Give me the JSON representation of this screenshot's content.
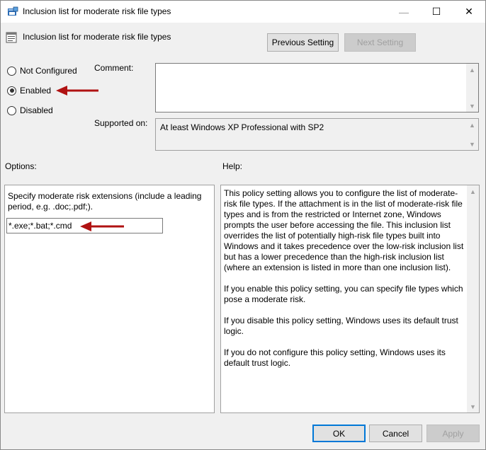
{
  "window": {
    "title": "Inclusion list for moderate risk file types",
    "minimize_glyph": "—",
    "maximize_glyph": "☐",
    "close_glyph": "✕"
  },
  "header": {
    "title": "Inclusion list for moderate risk file types",
    "prev_label": "Previous Setting",
    "next_label": "Next Setting"
  },
  "state": {
    "options": [
      "Not Configured",
      "Enabled",
      "Disabled"
    ],
    "selected": "Enabled"
  },
  "comment": {
    "label": "Comment:",
    "value": ""
  },
  "supported": {
    "label": "Supported on:",
    "value": "At least Windows XP Professional with SP2"
  },
  "options_section": {
    "label": "Options:",
    "description": "Specify moderate risk extensions (include a leading period, e.g. .doc;.pdf;).",
    "extensions_value": "*.exe;*.bat;*.cmd"
  },
  "help": {
    "label": "Help:",
    "paragraphs": [
      "This policy setting allows you to configure the list of moderate-risk file types. If the attachment is in the list of moderate-risk file types and is from the restricted or Internet zone, Windows prompts the user before accessing the file. This inclusion list overrides the list of potentially high-risk file types built into Windows and it takes precedence over the low-risk inclusion list but has a lower precedence than the high-risk inclusion list (where an extension is listed in more than one inclusion list).",
      "If you enable this policy setting, you can specify file types which pose a moderate risk.",
      "If you disable this policy setting, Windows uses its default trust logic.",
      "If you do not configure this policy setting, Windows uses its default trust logic."
    ]
  },
  "footer": {
    "ok_label": "OK",
    "cancel_label": "Cancel",
    "apply_label": "Apply"
  },
  "colors": {
    "annotation_arrow": "#b01212",
    "focus_blue": "#0078d7"
  },
  "icons": {
    "window": "policy-icon",
    "header": "settings-icon"
  }
}
